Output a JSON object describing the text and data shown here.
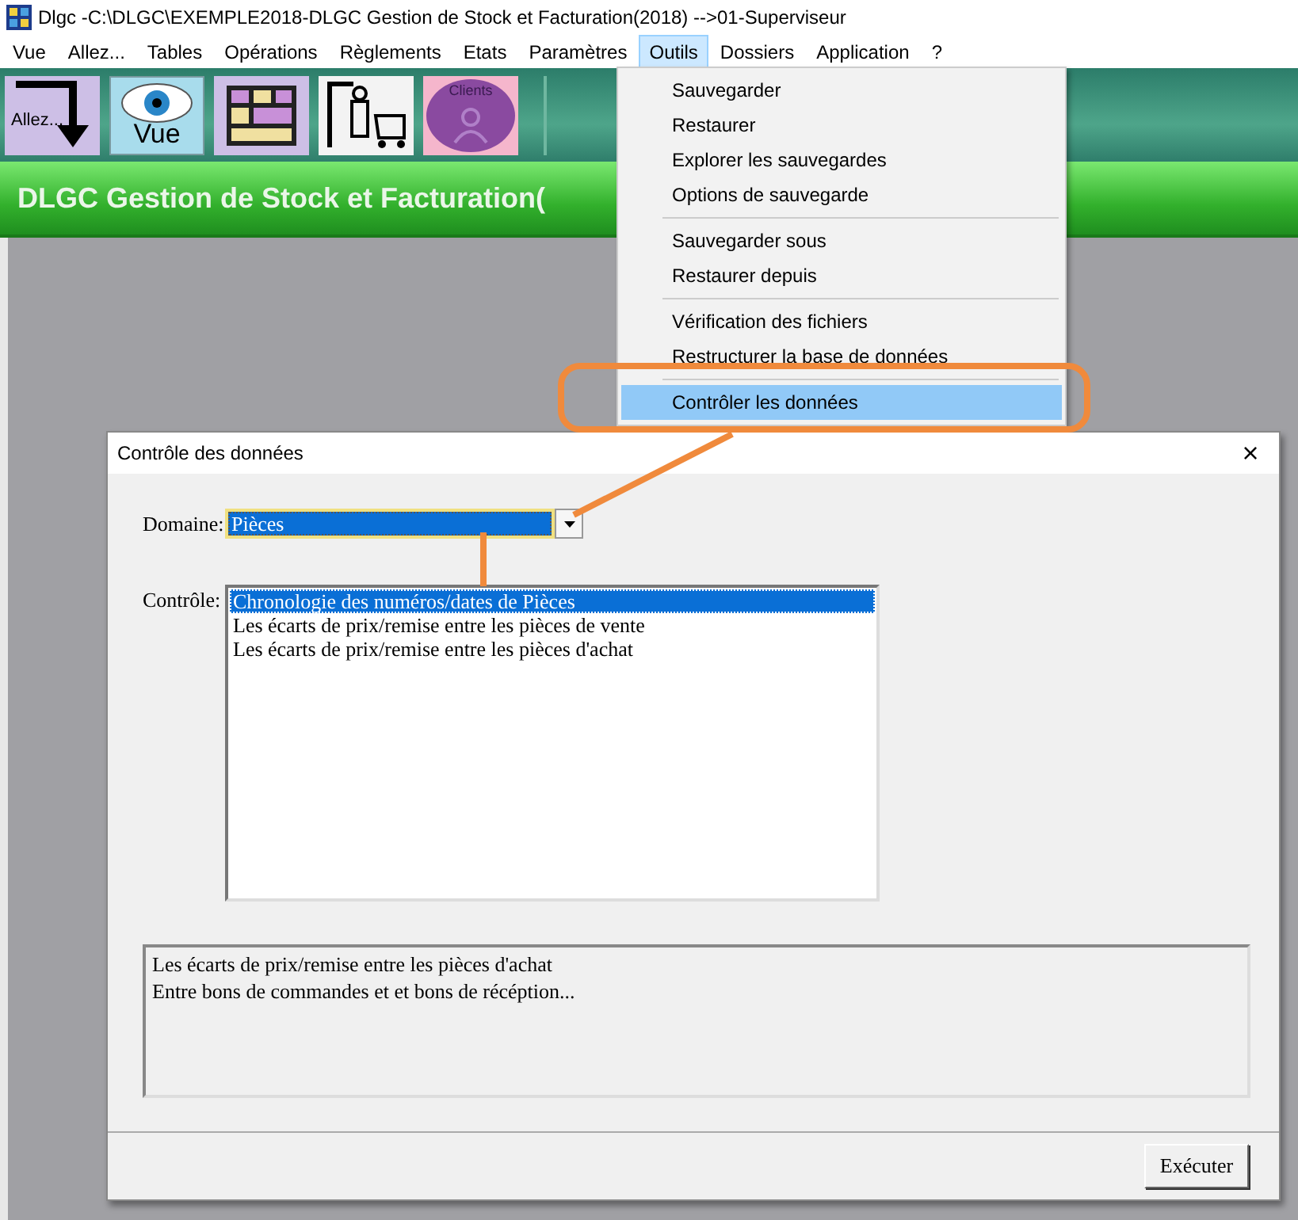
{
  "window": {
    "title": "Dlgc -C:\\DLGC\\EXEMPLE2018-DLGC Gestion de Stock et Facturation(2018) -->01-Superviseur"
  },
  "menu_bar": [
    {
      "label": "Vue",
      "selected": false
    },
    {
      "label": "Allez...",
      "selected": false
    },
    {
      "label": "Tables",
      "selected": false
    },
    {
      "label": "Opérations",
      "selected": false
    },
    {
      "label": "Règlements",
      "selected": false
    },
    {
      "label": "Etats",
      "selected": false
    },
    {
      "label": "Paramètres",
      "selected": false
    },
    {
      "label": "Outils",
      "selected": true
    },
    {
      "label": "Dossiers",
      "selected": false
    },
    {
      "label": "Application",
      "selected": false
    },
    {
      "label": "?",
      "selected": false
    }
  ],
  "toolbar": [
    {
      "kind": "goto",
      "label": "Allez..."
    },
    {
      "kind": "view",
      "label": "Vue"
    },
    {
      "kind": "tables"
    },
    {
      "kind": "stock"
    },
    {
      "kind": "clients",
      "label": "Clients"
    }
  ],
  "banner": {
    "title": "DLGC Gestion de Stock et Facturation("
  },
  "outils_menu": [
    {
      "kind": "item",
      "label": "Sauvegarder",
      "selected": false
    },
    {
      "kind": "item",
      "label": "Restaurer",
      "selected": false
    },
    {
      "kind": "item",
      "label": "Explorer les sauvegardes",
      "selected": false
    },
    {
      "kind": "item",
      "label": "Options de sauvegarde",
      "selected": false
    },
    {
      "kind": "separator"
    },
    {
      "kind": "item",
      "label": "Sauvegarder sous",
      "selected": false
    },
    {
      "kind": "item",
      "label": "Restaurer depuis",
      "selected": false
    },
    {
      "kind": "separator"
    },
    {
      "kind": "item",
      "label": "Vérification des fichiers",
      "selected": false
    },
    {
      "kind": "item",
      "label": "Restructurer la base de données",
      "selected": false
    },
    {
      "kind": "separator"
    },
    {
      "kind": "item",
      "label": "Contrôler les données",
      "selected": true
    }
  ],
  "dialog": {
    "title": "Contrôle des données",
    "close": "×",
    "domain": {
      "label": "Domaine:",
      "value": "Pièces"
    },
    "control": {
      "label": "Contrôle:",
      "items": [
        {
          "text": "Chronologie des numéros/dates de Pièces",
          "selected": true
        },
        {
          "text": "Les écarts de prix/remise entre les pièces de vente",
          "selected": false
        },
        {
          "text": "Les écarts de prix/remise entre les pièces d'achat",
          "selected": false
        }
      ]
    },
    "description": [
      "Les écarts de prix/remise entre les pièces d'achat",
      "Entre bons de commandes et et bons de récéption..."
    ],
    "button": "Exécuter"
  }
}
